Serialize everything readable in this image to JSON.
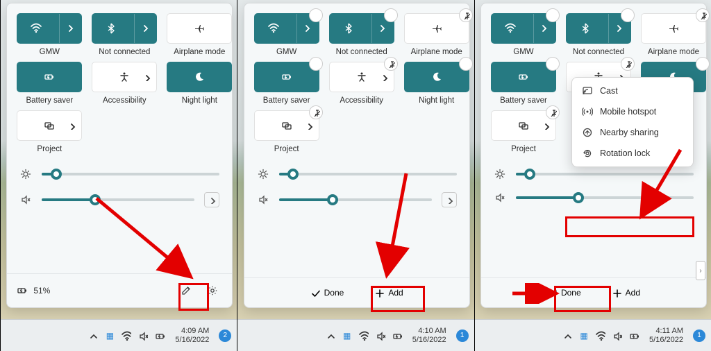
{
  "tiles": {
    "wifi": {
      "label": "GMW"
    },
    "bluetooth": {
      "label": "Not connected"
    },
    "airplane": {
      "label": "Airplane mode"
    },
    "battery_saver": {
      "label": "Battery saver"
    },
    "accessibility": {
      "label": "Accessibility"
    },
    "night_light": {
      "label": "Night light"
    },
    "project": {
      "label": "Project"
    }
  },
  "sliders": {
    "brightness_pct": 8,
    "volume_pct": 35
  },
  "footer": {
    "battery_pct": "51%",
    "done_label": "Done",
    "add_label": "Add"
  },
  "add_menu": {
    "cast": "Cast",
    "hotspot": "Mobile hotspot",
    "nearby": "Nearby sharing",
    "rotation": "Rotation lock"
  },
  "taskbar": {
    "stage1": {
      "time": "4:09 AM",
      "date": "5/16/2022",
      "notif_count": "2"
    },
    "stage2": {
      "time": "4:10 AM",
      "date": "5/16/2022",
      "notif_count": "1"
    },
    "stage3": {
      "time": "4:11 AM",
      "date": "5/16/2022",
      "notif_count": "1"
    }
  }
}
